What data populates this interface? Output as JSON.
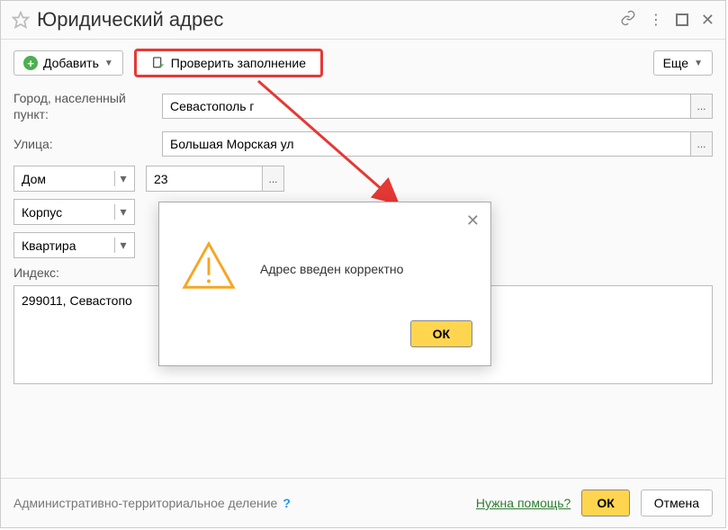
{
  "title": "Юридический адрес",
  "toolbar": {
    "add_label": "Добавить",
    "check_label": "Проверить заполнение",
    "more_label": "Еще"
  },
  "fields": {
    "city_label": "Город, населенный пункт:",
    "city_value": "Севастополь г",
    "street_label": "Улица:",
    "street_value": "Большая Морская ул",
    "house_type": "Дом",
    "house_value": "23",
    "building_type": "Корпус",
    "building_value": "",
    "apartment_type": "Квартира",
    "apartment_value": "",
    "index_label": "Индекс:",
    "address_value": "299011, Севастопо"
  },
  "footer": {
    "div_label": "Административно-территориальное деление",
    "help_link": "Нужна помощь?",
    "ok_label": "ОК",
    "cancel_label": "Отмена"
  },
  "dialog": {
    "message": "Адрес введен корректно",
    "ok_label": "ОК"
  }
}
